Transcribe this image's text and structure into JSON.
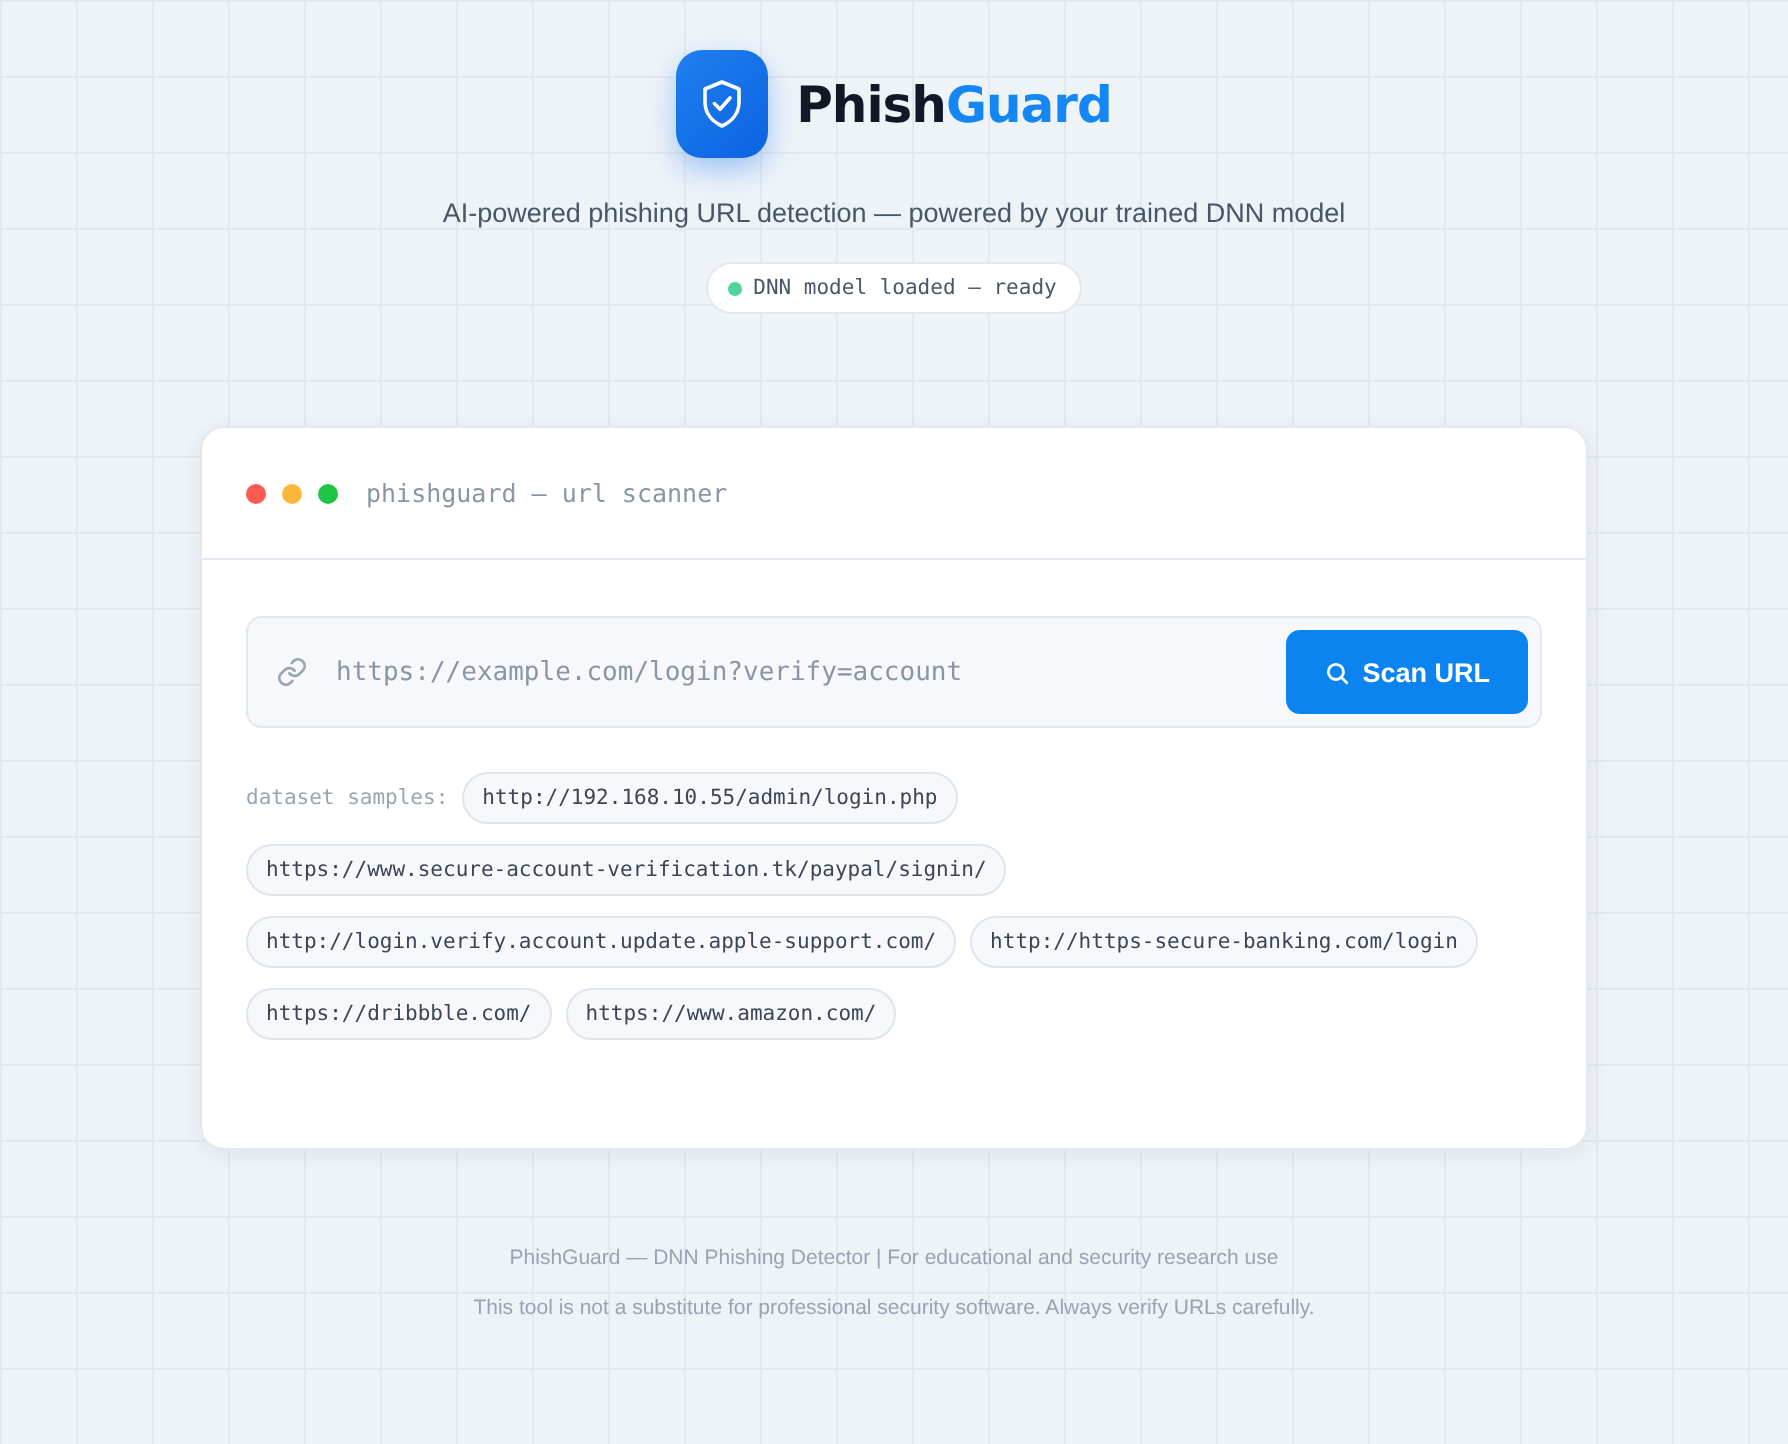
{
  "brand": {
    "lead": "Phish",
    "accent": "Guard"
  },
  "tagline": "AI-powered phishing URL detection — powered by your trained DNN model",
  "status": {
    "label": "DNN model loaded — ready",
    "ready": true
  },
  "scanner": {
    "title": "phishguard — url scanner",
    "url_field": {
      "placeholder": "https://example.com/login?verify=account"
    },
    "scan_button": "Scan URL",
    "samples_label": "dataset samples:",
    "samples": [
      "http://192.168.10.55/admin/login.php",
      "https://www.secure-account-verification.tk/paypal/signin/",
      "http://login.verify.account.update.apple-support.com/",
      "http://https-secure-banking.com/login",
      "https://dribbble.com/",
      "https://www.amazon.com/"
    ]
  },
  "footer": [
    "PhishGuard — DNN Phishing Detector | For educational and security research use",
    "This tool is not a substitute for professional security software. Always verify URLs carefully."
  ]
}
